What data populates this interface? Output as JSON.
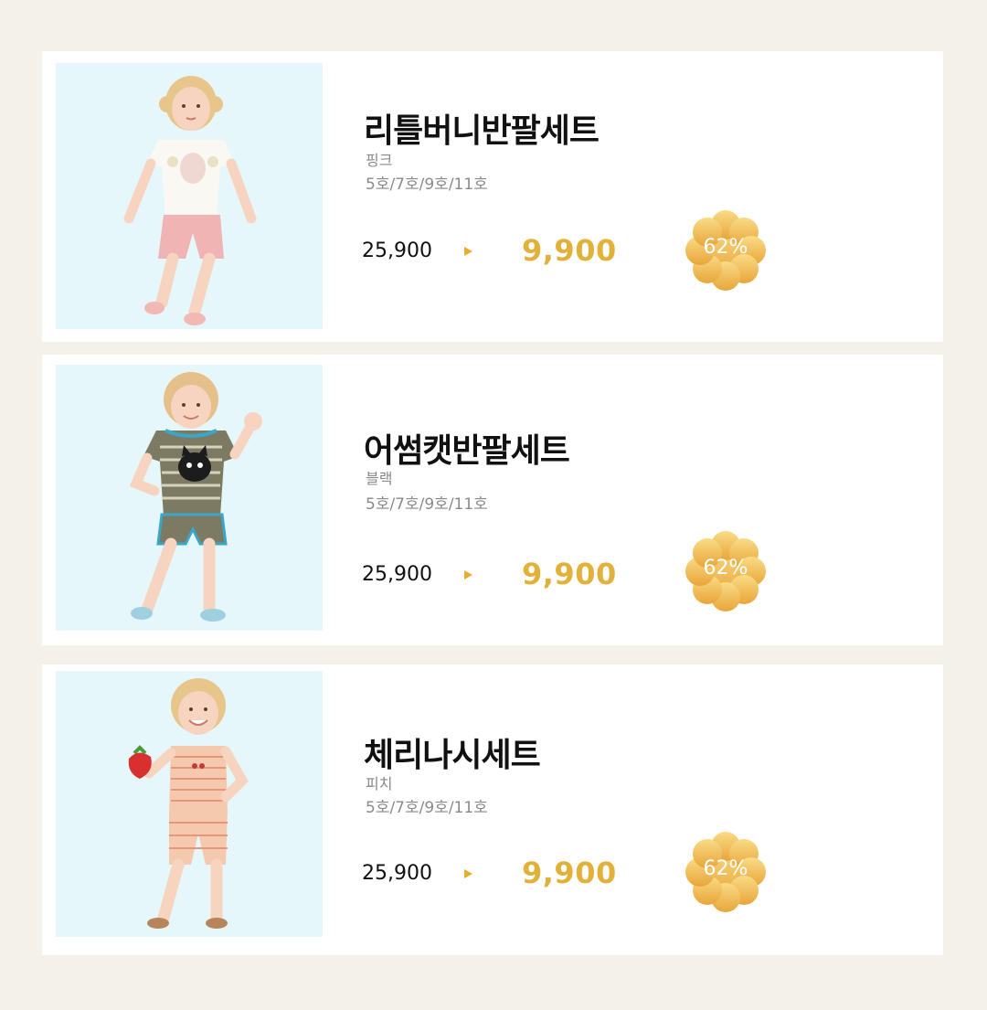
{
  "products": [
    {
      "name": "리틀버니반팔세트",
      "color": "핑크",
      "sizes": "5호/7호/9호/11호",
      "original_price": "25,900",
      "sale_price": "9,900",
      "discount": "62%"
    },
    {
      "name": "어썸캣반팔세트",
      "color": "블랙",
      "sizes": "5호/7호/9호/11호",
      "original_price": "25,900",
      "sale_price": "9,900",
      "discount": "62%"
    },
    {
      "name": "체리나시세트",
      "color": "피치",
      "sizes": "5호/7호/9호/11호",
      "original_price": "25,900",
      "sale_price": "9,900",
      "discount": "62%"
    }
  ],
  "colors": {
    "page_bg": "#f3f1ea",
    "card_bg": "#ffffff",
    "photo_bg": "#e6f7fb",
    "sale_price": "#e2b13a",
    "badge_gradient_top": "#f9dc86",
    "badge_gradient_bottom": "#e9a53a",
    "arrow": "#e7ad2e"
  },
  "icons": {
    "arrow": "triangle-right-icon",
    "badge": "flower-badge-icon"
  }
}
